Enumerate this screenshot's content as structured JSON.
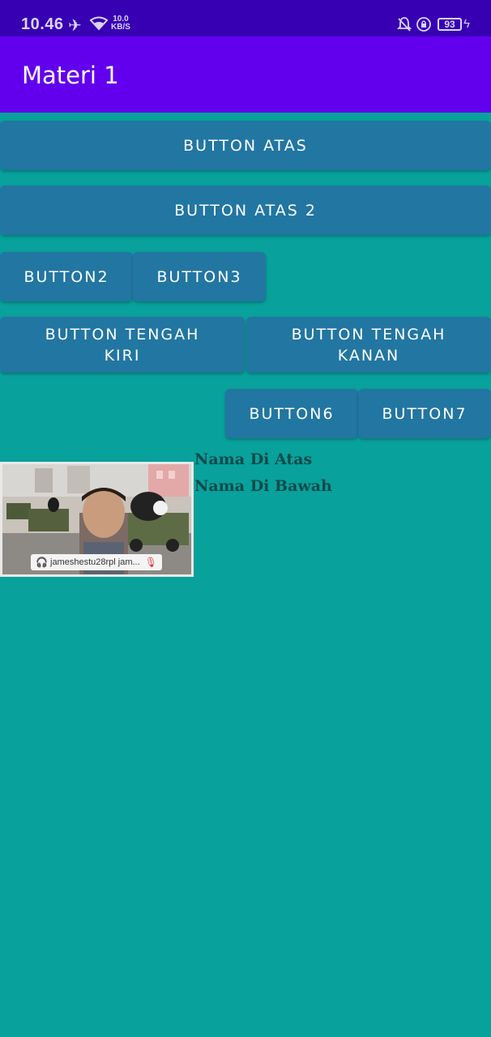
{
  "status_bar": {
    "time": "10.46",
    "net_speed_value": "10.0",
    "net_speed_unit": "KB/S",
    "battery": "93",
    "icons": [
      "airplane-icon",
      "wifi-icon",
      "bell-off-icon",
      "lock-rotation-icon",
      "battery-icon",
      "charging-icon"
    ]
  },
  "app_bar": {
    "title": "Materi 1"
  },
  "buttons": {
    "atas": "Button Atas",
    "atas2": "Button Atas 2",
    "b2": "Button2",
    "b3": "Button3",
    "tengah_kiri_line1": "Button Tengah",
    "tengah_kiri_line2": "Kiri",
    "tengah_kanan_line1": "Button Tengah",
    "tengah_kanan_line2": "Kanan",
    "b6": "Button6",
    "b7": "Button7"
  },
  "image": {
    "caption": "jameshestu28rpl jam..."
  },
  "texts": {
    "nama_atas": "Nama Di Atas",
    "nama_bawah": "Nama Di Bawah"
  },
  "colors": {
    "status_bar": "#3700b3",
    "app_bar": "#6200ee",
    "background": "#08a19b",
    "button": "#2276a2",
    "name_text": "#104a4a"
  }
}
